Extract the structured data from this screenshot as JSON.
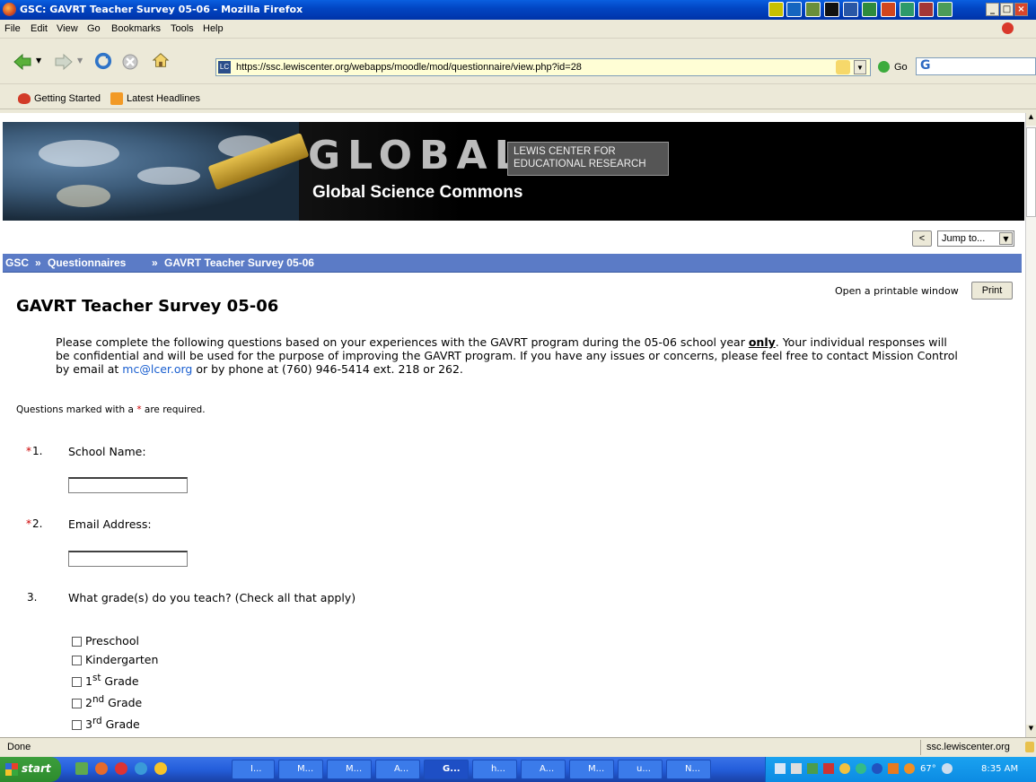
{
  "window": {
    "title": "GSC: GAVRT Teacher Survey 05-06 - Mozilla Firefox",
    "controls": [
      "_",
      "□",
      "×"
    ]
  },
  "menu": [
    "File",
    "Edit",
    "View",
    "Go",
    "Bookmarks",
    "Tools",
    "Help"
  ],
  "toolbar": {
    "url": "https://ssc.lewiscenter.org/webapps/moodle/mod/questionnaire/view.php?id=28",
    "go_label": "Go",
    "search_glyph": "G"
  },
  "bookmarks": [
    "Getting Started",
    "Latest Headlines"
  ],
  "banner": {
    "logo": "GLOBAL",
    "org_line1": "LEWIS CENTER FOR",
    "org_line2": "EDUCATIONAL RESEARCH",
    "subtitle": "Global Science Commons"
  },
  "jump": {
    "back": "<",
    "select": "Jump to..."
  },
  "breadcrumb": [
    "GSC",
    "Questionnaires",
    "GAVRT Teacher Survey 05-06"
  ],
  "print": {
    "text": "Open a printable window",
    "button": "Print"
  },
  "page": {
    "title": "GAVRT Teacher Survey 05-06",
    "intro_before": "Please complete the following questions based on your experiences with the GAVRT program during the 05-06 school year ",
    "intro_bold": "only",
    "intro_after": ". Your individual responses will be confidential and will be used for the purpose of improving the GAVRT program. If you have any issues or concerns, please feel free to contact Mission Control by email at ",
    "email": "mc@lcer.org",
    "intro_end": " or by phone at (760) 946-5414 ext. 218 or 262.",
    "required_note_before": "Questions marked with a ",
    "required_star": "*",
    "required_note_after": " are required."
  },
  "questions": [
    {
      "num": "1.",
      "required": "*",
      "text": "School Name:"
    },
    {
      "num": "2.",
      "required": "*",
      "text": "Email Address:"
    },
    {
      "num": "3.",
      "required": "",
      "text": "What grade(s) do you teach? (Check all that apply)"
    }
  ],
  "grades": [
    {
      "label": "Preschool",
      "sup": "",
      "after": ""
    },
    {
      "label": "Kindergarten",
      "sup": "",
      "after": ""
    },
    {
      "label": "1",
      "sup": "st",
      "after": " Grade"
    },
    {
      "label": "2",
      "sup": "nd",
      "after": " Grade"
    },
    {
      "label": "3",
      "sup": "rd",
      "after": " Grade"
    }
  ],
  "status": {
    "left": "Done",
    "right": "ssc.lewiscenter.org"
  },
  "taskbar": {
    "start": "start",
    "items": [
      "I...",
      "M...",
      "M...",
      "A...",
      "G...",
      "h...",
      "A...",
      "M...",
      "u...",
      "N..."
    ],
    "temp": "67°",
    "clock": "8:35 AM"
  },
  "colors": {
    "titlebar": "#0a5fe0",
    "crumb_bar": "#5b7bc6",
    "required": "#cc0000",
    "link": "#1a5fd0",
    "taskbar": "#245edb"
  }
}
